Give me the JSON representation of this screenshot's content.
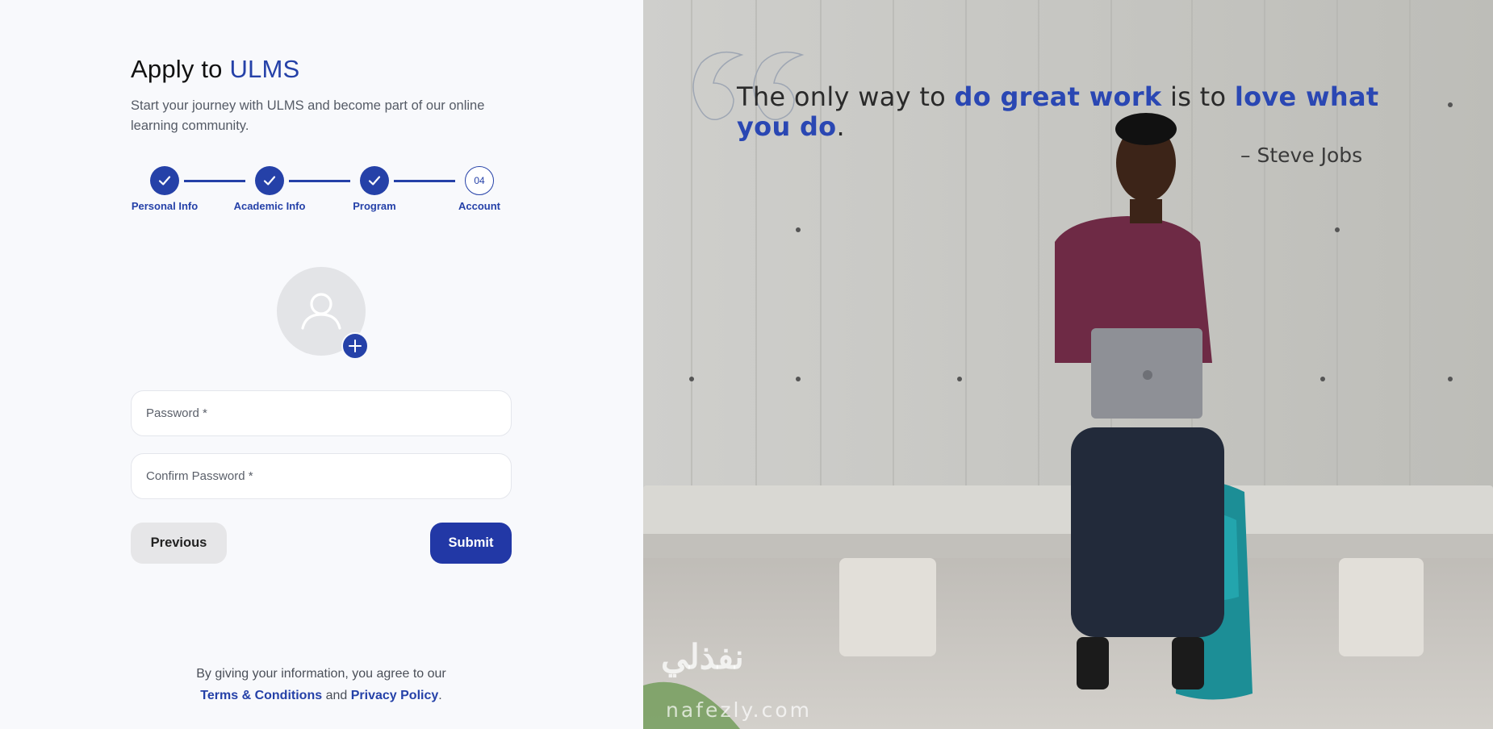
{
  "header": {
    "title_prefix": "Apply to",
    "title_brand": "ULMS",
    "subtitle": "Start your journey with ULMS and become part of our online learning community."
  },
  "stepper": {
    "steps": [
      {
        "label": "Personal Info",
        "status": "completed"
      },
      {
        "label": "Academic Info",
        "status": "completed"
      },
      {
        "label": "Program",
        "status": "completed"
      },
      {
        "label": "Account",
        "status": "current",
        "number": "04"
      }
    ]
  },
  "avatar": {
    "icon": "user-icon",
    "add_icon": "plus-icon"
  },
  "form": {
    "password_placeholder": "Password *",
    "confirm_password_placeholder": "Confirm Password *",
    "previous_label": "Previous",
    "submit_label": "Submit"
  },
  "footer": {
    "text_before": "By giving your information, you agree to our",
    "terms_link": "Terms & Conditions",
    "and_text": "and",
    "privacy_link": "Privacy Policy",
    "end_text": "."
  },
  "hero": {
    "quote_part1": "The only way to",
    "quote_em1": "do great work",
    "quote_part2": "is to",
    "quote_em2": "love what you do",
    "quote_end": ".",
    "author": "– Steve Jobs",
    "watermark": "نفذلي",
    "watermark_sub": "nafezly.com"
  },
  "colors": {
    "accent": "#2541a8",
    "submit_bg": "#2238a6",
    "previous_bg": "#e6e6e8",
    "panel_bg": "#f8f9fc"
  }
}
